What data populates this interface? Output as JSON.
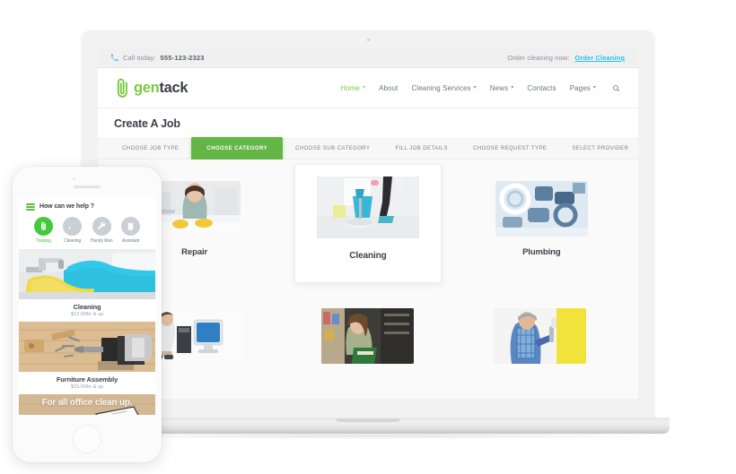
{
  "desktop": {
    "topbar": {
      "phone_icon": "phone-icon",
      "call_label": "Call today:",
      "phone_number": "555-123-2323",
      "order_label": "Order cleaning now:",
      "order_link": "Order Cleaning",
      "link_color": "#29c0ef"
    },
    "brand": {
      "icon": "paperclip-icon",
      "name_first": "gen",
      "name_second": "tack",
      "accent_color": "#7ac943"
    },
    "nav": {
      "items": [
        {
          "label": "Home",
          "caret": "⌄",
          "active": true
        },
        {
          "label": "About",
          "caret": "",
          "active": false
        },
        {
          "label": "Cleaning Services",
          "caret": "⌄",
          "active": false
        },
        {
          "label": "News",
          "caret": "⌄",
          "active": false
        },
        {
          "label": "Contacts",
          "caret": "",
          "active": false
        },
        {
          "label": "Pages",
          "caret": "⌄",
          "active": false
        }
      ],
      "search_icon": "search-icon"
    },
    "page_title": "Create A Job",
    "steps": [
      {
        "label": "CHOOSE JOB TYPE",
        "active": false
      },
      {
        "label": "CHOOSE CATEGORY",
        "active": true
      },
      {
        "label": "CHOOSE SUB CATEGORY",
        "active": false
      },
      {
        "label": "FILL JOB DETAILS",
        "active": false
      },
      {
        "label": "CHOOSE REQUEST TYPE",
        "active": false
      },
      {
        "label": "SELECT PROVIDER",
        "active": false
      }
    ],
    "step_active_color": "#63b646",
    "categories_row1": [
      {
        "label": "Repair",
        "image": "woman-cleaning-counter-photo",
        "featured": false
      },
      {
        "label": "Cleaning",
        "image": "mop-and-bucket-photo",
        "featured": true
      },
      {
        "label": "Plumbing",
        "image": "pipe-fittings-photo",
        "featured": false
      }
    ],
    "categories_row2": [
      {
        "label": "",
        "image": "technician-computer-repair-photo",
        "featured": false
      },
      {
        "label": "",
        "image": "woman-grocery-shopping-photo",
        "featured": false
      },
      {
        "label": "",
        "image": "painter-yellow-roller-photo",
        "featured": false
      }
    ]
  },
  "phone": {
    "menu_icon": "hamburger-menu-icon",
    "header_title": "How can we help ?",
    "services": [
      {
        "label": "Training",
        "icon": "paperclip-icon",
        "active": true
      },
      {
        "label": "Cleaning",
        "icon": "spray-icon",
        "active": false
      },
      {
        "label": "Handy Man",
        "icon": "wrench-icon",
        "active": false
      },
      {
        "label": "Assistant",
        "icon": "clipboard-icon",
        "active": false
      }
    ],
    "active_color": "#44c93c",
    "cards": [
      {
        "name": "Cleaning",
        "price": "$12.00/hr & up",
        "image": "gloved-hands-cleaning-sink-photo"
      },
      {
        "name": "Furniture Assembly",
        "price": "$15.00/hr & up",
        "image": "drill-and-screws-on-wood-photo"
      }
    ],
    "promo_text": "For all office clean up.",
    "promo_image": "wooden-desk-photo"
  }
}
